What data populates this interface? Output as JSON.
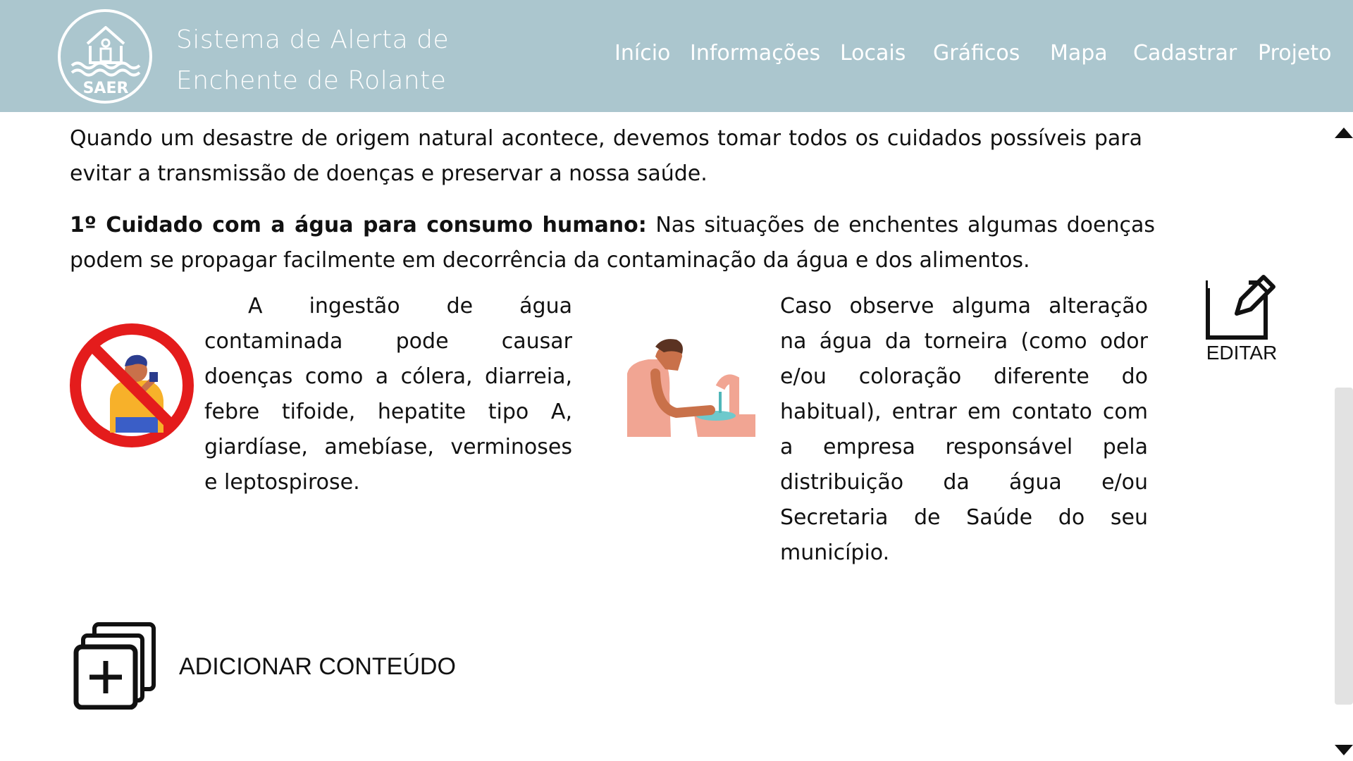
{
  "header": {
    "brand_line1": "Sistema de Alerta de",
    "brand_line2": "Enchente de Rolante",
    "logo_text": "SAER",
    "background": "#abc6ce"
  },
  "nav": {
    "items": [
      {
        "label": "Início",
        "id": "inicio"
      },
      {
        "label": "Informações",
        "id": "informacoes"
      },
      {
        "label": "Locais",
        "id": "locais"
      },
      {
        "label": "Gráficos",
        "id": "graficos"
      },
      {
        "label": "Mapa",
        "id": "mapa"
      },
      {
        "label": "Cadastrar",
        "id": "cadastrar"
      },
      {
        "label": "Projeto",
        "id": "projeto"
      }
    ]
  },
  "content": {
    "intro": "Quando um desastre de origem natural acontece, devemos tomar todos os cuidados possíveis para evitar a transmissão de doenças e preservar a nossa saúde.",
    "section_title": "1º Cuidado com a água para consumo humano:",
    "section_text": " Nas situações de enchentes algumas doenças podem se propagar facilmente em decorrência da contaminação da água e dos alimentos.",
    "left_text": "A ingestão de água contaminada pode causar doenças como a cólera, diarreia, febre tifoide, hepatite tipo A, giardíase, amebíase, verminoses e leptospirose.",
    "right_text": "Caso observe alguma alteração na água da torneira (como odor e/ou coloração diferente do habitual), entrar em contato com a empresa responsável pela distribuição da água e/ou Secretaria de Saúde do seu município."
  },
  "actions": {
    "edit_label": "EDITAR",
    "add_label": "ADICIONAR CONTEÚDO"
  },
  "icons": {
    "logo": "house-flood-icon",
    "edit": "edit-icon",
    "add": "add-content-icon",
    "no_drink": "no-drinking-icon",
    "wash": "washing-hands-icon"
  }
}
